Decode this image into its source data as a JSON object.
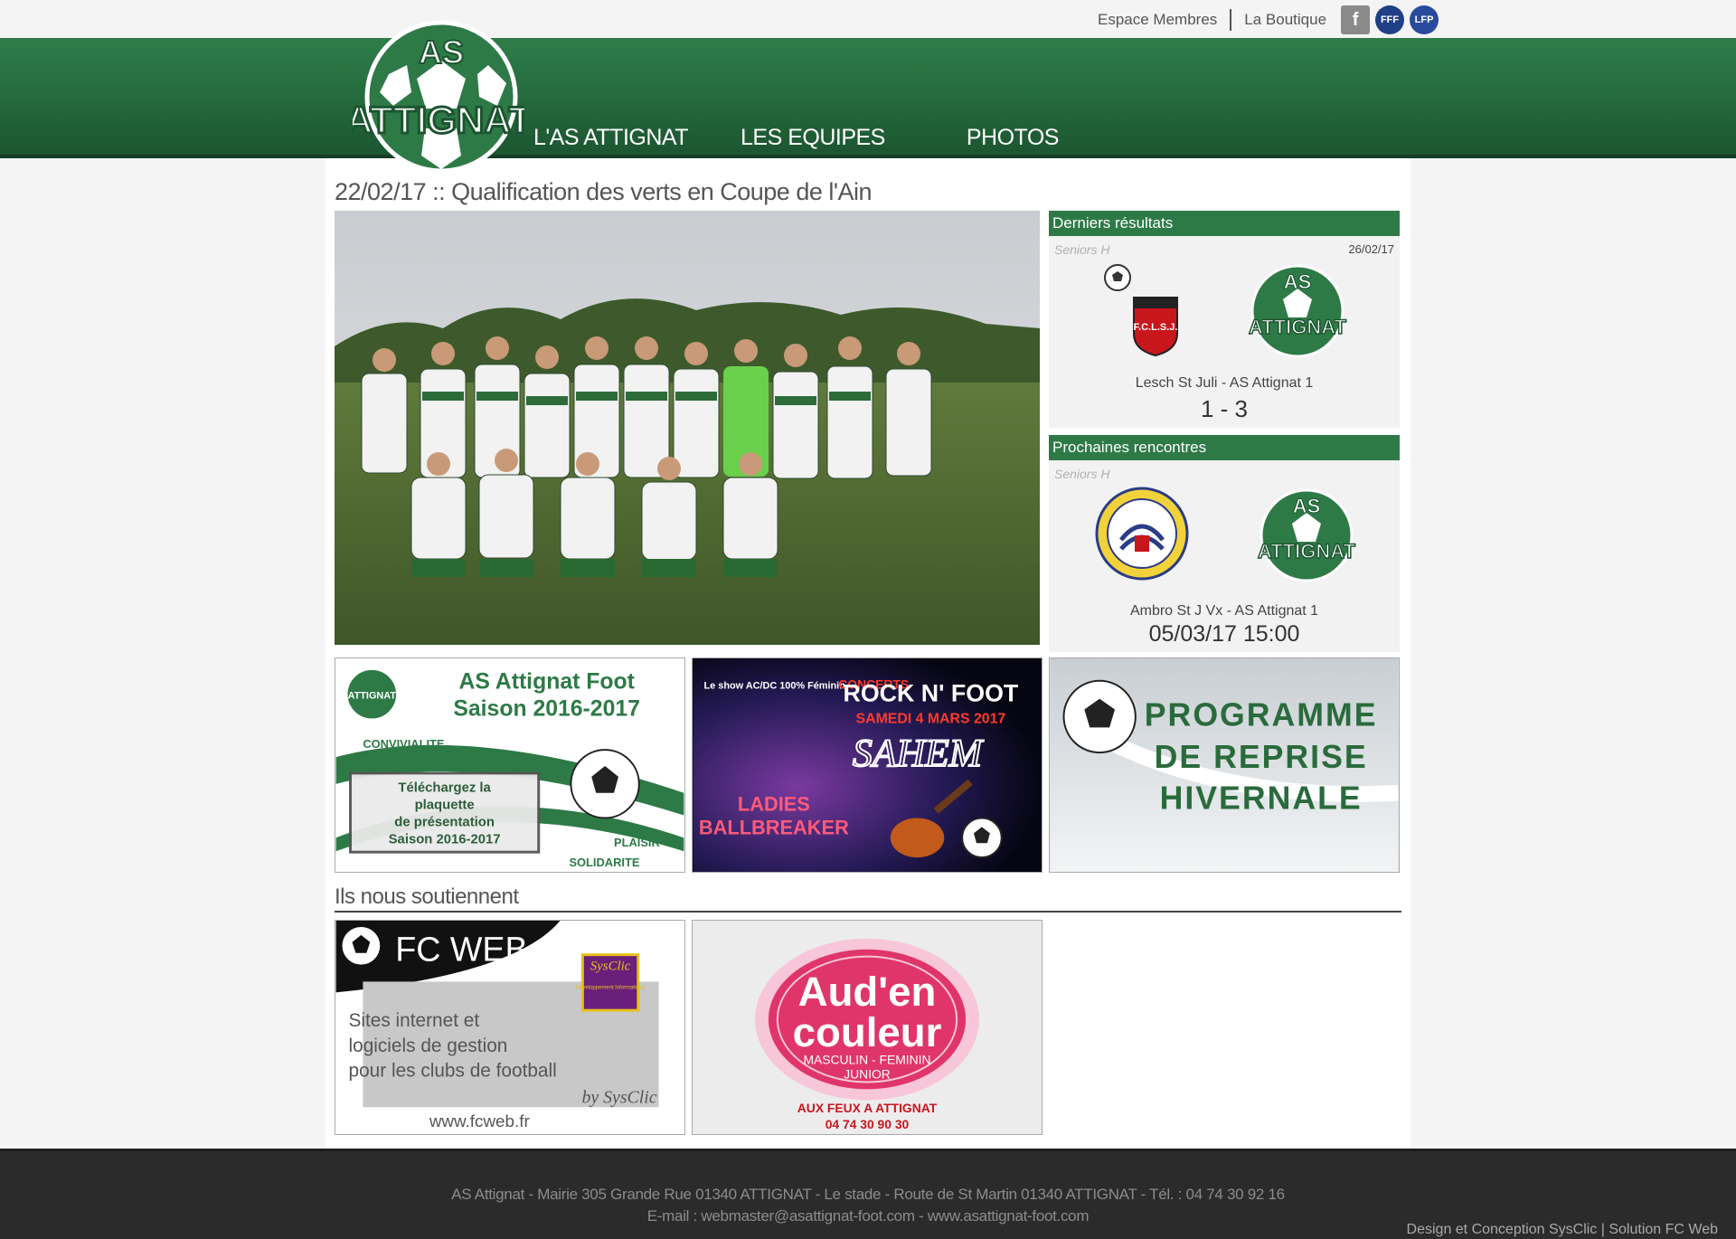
{
  "topbar": {
    "links": [
      "Espace Membres",
      "La Boutique"
    ],
    "social": [
      {
        "icon": "facebook-icon",
        "glyph": "f"
      },
      {
        "icon": "fff-logo-icon",
        "glyph": "FFF"
      },
      {
        "icon": "lfp-logo-icon",
        "glyph": "LFP"
      }
    ]
  },
  "logo": {
    "top_text": "AS",
    "bottom_text": "ATTIGNAT"
  },
  "nav": [
    "L'AS ATTIGNAT",
    "LES EQUIPES",
    "PHOTOS"
  ],
  "news": {
    "title": "22/02/17 :: Qualification des verts en Coupe de l'Ain"
  },
  "results": {
    "header": "Derniers résultats",
    "category": "Seniors H",
    "date": "26/02/17",
    "home_badge": "F.C.L.S.J.",
    "match": "Lesch St Juli - AS Attignat 1",
    "score": "1 - 3"
  },
  "upcoming": {
    "header": "Prochaines rencontres",
    "category": "Seniors H",
    "match": "Ambro St J Vx - AS Attignat 1",
    "datetime": "05/03/17 15:00"
  },
  "banners": {
    "plaquette": {
      "title1": "AS Attignat Foot",
      "title2": "Saison 2016-2017",
      "words": [
        "CONVIVIALITE",
        "PLAISIR",
        "SOLIDARITE"
      ],
      "box": [
        "Téléchargez la",
        "plaquette",
        "de présentation",
        "Saison 2016-2017"
      ]
    },
    "concert": {
      "top_left": "Le show AC/DC 100% Féminin",
      "concerts": "CONCERTS",
      "title": "ROCK N' FOOT",
      "date": "SAMEDI 4 MARS 2017",
      "band": "SAHEM",
      "ladies": [
        "LADIES",
        "BALLBREAKER"
      ]
    },
    "programme": {
      "lines": [
        "PROGRAMME",
        "DE REPRISE",
        "HIVERNALE"
      ]
    }
  },
  "sponsors": {
    "title": "Ils nous soutiennent",
    "fcweb": {
      "title": "FC WEB",
      "brand": "SysClic",
      "brand_sub": "Développement Informatique",
      "lines": [
        "Sites internet et",
        "logiciels de gestion",
        "pour les clubs de football"
      ],
      "by": "by SysClic",
      "url": "www.fcweb.fr"
    },
    "auden": {
      "name1": "Aud'en",
      "name2": "couleur",
      "sub1": "MASCULIN - FEMININ",
      "sub2": "JUNIOR",
      "addr": "AUX FEUX A ATTIGNAT",
      "phone": "04 74 30 90 30"
    }
  },
  "footer": {
    "line1": "AS Attignat - Mairie 305 Grande Rue 01340 ATTIGNAT - Le stade - Route de St Martin 01340 ATTIGNAT - Tél. : 04 74 30 92 16",
    "line2": "E-mail : webmaster@asattignat-foot.com - www.asattignat-foot.com",
    "credit": "Design et Conception SysClic | Solution FC Web"
  },
  "colors": {
    "brand_green": "#2e7a47",
    "header_dark": "#1c5430",
    "footer_bg": "#2b2b2b"
  }
}
